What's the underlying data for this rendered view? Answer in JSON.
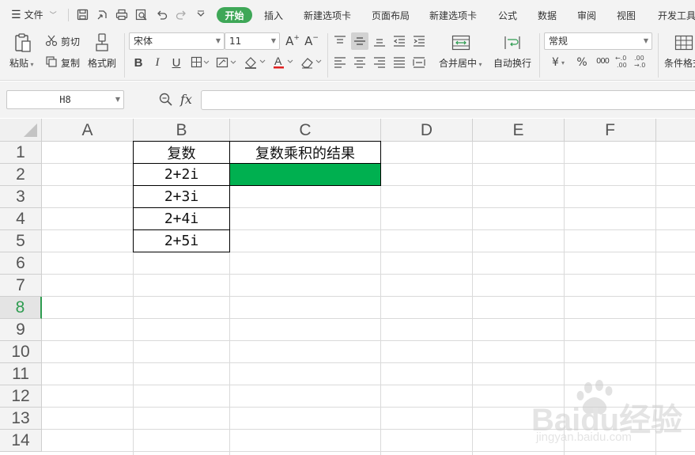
{
  "menu": {
    "file_label": "文件",
    "tabs": [
      "开始",
      "插入",
      "新建选项卡",
      "页面布局",
      "新建选项卡",
      "公式",
      "数据",
      "审阅",
      "视图",
      "开发工具"
    ],
    "active_tab_color": "#3ea757"
  },
  "ribbon": {
    "paste_label": "粘贴",
    "cut_label": "剪切",
    "copy_label": "复制",
    "format_painter_label": "格式刷",
    "font_name": "宋体",
    "font_size": "11",
    "font_color_underline": "#e02020",
    "merge_center_label": "合并居中",
    "wrap_text_label": "自动换行",
    "number_format": "常规",
    "currency_symbol": "¥",
    "percent_symbol": "%",
    "thousands_symbol": "000",
    "decimal_increase": "+.0\n.00",
    "decimal_decrease": "-.00\n.0",
    "conditional_format_label": "条件格式"
  },
  "formula_bar": {
    "name_box": "H8",
    "fx_label": "fx",
    "formula_value": ""
  },
  "sheet": {
    "columns": [
      "A",
      "B",
      "C",
      "D",
      "E",
      "F"
    ],
    "rows": [
      "1",
      "2",
      "3",
      "4",
      "5",
      "6",
      "7",
      "8",
      "9",
      "10",
      "11",
      "12",
      "13",
      "14"
    ],
    "active_row": "8",
    "cells": {
      "B1": "复数",
      "C1": "复数乘积的结果",
      "B2": "2+2i",
      "B3": "2+3i",
      "B4": "2+4i",
      "B5": "2+5i"
    },
    "highlight_color": "#00b050"
  },
  "watermark": {
    "brand": "Baidu经验",
    "url": "jingyan.baidu.com"
  }
}
